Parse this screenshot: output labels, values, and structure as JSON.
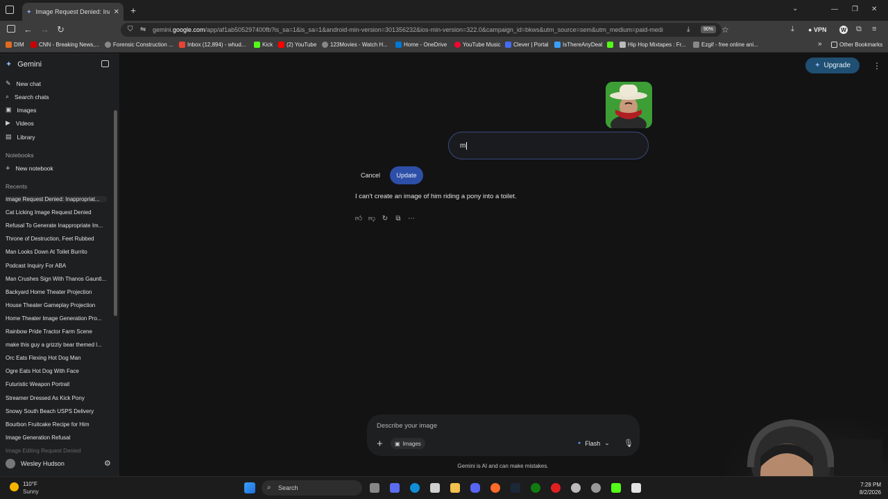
{
  "browser": {
    "tab_title": "Image Request Denied: Inappr",
    "url_prefix": "gemini.",
    "url_host": "google.com",
    "url_rest": "/app/af1ab505297400fb?is_sa=1&is_sa=1&android-min-version=301356232&ios-min-version=322.0&campaign_id=bkws&utm_source=sem&utm_medium=paid-medi",
    "zoom": "90%",
    "vpn_label": "VPN",
    "bookmarks": [
      {
        "label": "DIM",
        "color": "#e06c1e"
      },
      {
        "label": "CNN - Breaking News,...",
        "color": "#cc0000"
      },
      {
        "label": "Forensic Construction ...",
        "color": "#888888"
      },
      {
        "label": "Inbox (12,894) - whud...",
        "color": "#ea4335"
      },
      {
        "label": "Kick",
        "color": "#53fc18"
      },
      {
        "label": "(2) YouTube",
        "color": "#ff0000"
      },
      {
        "label": "123Movies - Watch H...",
        "color": "#888888"
      },
      {
        "label": "Home - OneDrive",
        "color": "#0078d4"
      },
      {
        "label": "YouTube Music",
        "color": "#ff0033"
      },
      {
        "label": "Clever | Portal",
        "color": "#436cf2"
      },
      {
        "label": "IsThereAnyDeal",
        "color": "#3aa0ff"
      },
      {
        "label": "",
        "color": "#53fc18"
      },
      {
        "label": "Hip Hop Mixtapes : Fr...",
        "color": "#bbbbbb"
      },
      {
        "label": "Ezgif - free online ani...",
        "color": "#888888"
      }
    ],
    "other_bookmarks": "Other Bookmarks"
  },
  "sidebar": {
    "app_name": "Gemini",
    "nav": [
      {
        "label": "New chat",
        "icon": "new-chat-icon"
      },
      {
        "label": "Search chats",
        "icon": "search-icon"
      },
      {
        "label": "Images",
        "icon": "image-icon"
      },
      {
        "label": "Videos",
        "icon": "video-icon"
      },
      {
        "label": "Library",
        "icon": "library-icon"
      }
    ],
    "notebooks_label": "Notebooks",
    "new_notebook": "New notebook",
    "recents_label": "Recents",
    "recents": [
      "Image Request Denied: Inappropriat...",
      "Cat Licking Image Request Denied",
      "Refusal To Generate Inappropriate Im...",
      "Throne of Destruction, Feet Rubbed",
      "Man Looks Down At Toilet Burrito",
      "Podcast Inquiry For ABA",
      "Man Crushes Sign With Thanos Gauntl...",
      "Backyard Home Theater Projection",
      "House Theater Gameplay Projection",
      "Home Theater Image Generation Pro...",
      "Rainbow Pride Tractor Farm Scene",
      "make this guy a grizzly bear themed l...",
      "Orc Eats Flexing Hot Dog Man",
      "Ogre Eats Hot Dog With Face",
      "Futuristic Weapon Portrait",
      "Streamer Dressed As Kick Pony",
      "Snowy South Beach USPS Delivery",
      "Bourbon Fruitcake Recipe for Him",
      "Image Generation Refusal",
      "Image Editing Request Denied"
    ],
    "user_name": "Wesley Hudson"
  },
  "main": {
    "upgrade_label": "Upgrade",
    "edit_value": "m",
    "cancel_label": "Cancel",
    "update_label": "Update",
    "response_text": "I can't create an image of him riding a pony into a toilet.",
    "prompt_placeholder": "Describe your image",
    "images_chip": "Images",
    "model_label": "Flash",
    "disclaimer": "Gemini is AI and can make mistakes."
  },
  "taskbar": {
    "temperature": "110°F",
    "weather": "Sunny",
    "search_label": "Search",
    "time": "7:28 PM",
    "date": "8/2/2026"
  }
}
